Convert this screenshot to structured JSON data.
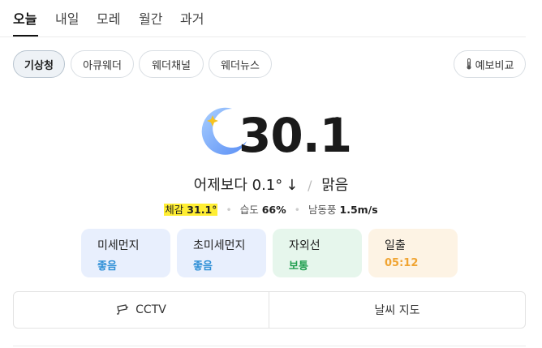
{
  "tabs": [
    {
      "label": "오늘",
      "active": true
    },
    {
      "label": "내일",
      "active": false
    },
    {
      "label": "모레",
      "active": false
    },
    {
      "label": "월간",
      "active": false
    },
    {
      "label": "과거",
      "active": false
    }
  ],
  "sources": [
    {
      "label": "기상청",
      "active": true
    },
    {
      "label": "아큐웨더",
      "active": false
    },
    {
      "label": "웨더채널",
      "active": false
    },
    {
      "label": "웨더뉴스",
      "active": false
    }
  ],
  "compare_button": {
    "label": "예보비교",
    "icon": "thermometer-icon"
  },
  "current": {
    "icon": "crescent-moon-icon",
    "temperature": "30.1",
    "degree_symbol": "°",
    "compare_text": "어제보다",
    "compare_value": "0.1°",
    "compare_arrow": "↓",
    "condition": "맑음"
  },
  "details": {
    "feels_label": "체감",
    "feels_value": "31.1°",
    "humidity_label": "습도",
    "humidity_value": "66%",
    "wind_label": "남동풍",
    "wind_value": "1.5m/s"
  },
  "cards": [
    {
      "label": "미세먼지",
      "value": "좋음",
      "bg": "#e8effd",
      "color": "#2e8fd6"
    },
    {
      "label": "초미세먼지",
      "value": "좋음",
      "bg": "#e8effd",
      "color": "#2e8fd6"
    },
    {
      "label": "자외선",
      "value": "보통",
      "bg": "#e6f6ec",
      "color": "#1f9e4e"
    },
    {
      "label": "일출",
      "value": "05:12",
      "bg": "#fdf3e4",
      "color": "#f0a432"
    }
  ],
  "bottom_buttons": [
    {
      "label": "CCTV",
      "icon": "cctv-camera-icon"
    },
    {
      "label": "날씨 지도"
    }
  ],
  "colors": {
    "highlight": "#ffee33",
    "moon_gradient_start": "#9ec7ff",
    "moon_gradient_end": "#5b8ff5",
    "sparkle": "#f6c320"
  }
}
